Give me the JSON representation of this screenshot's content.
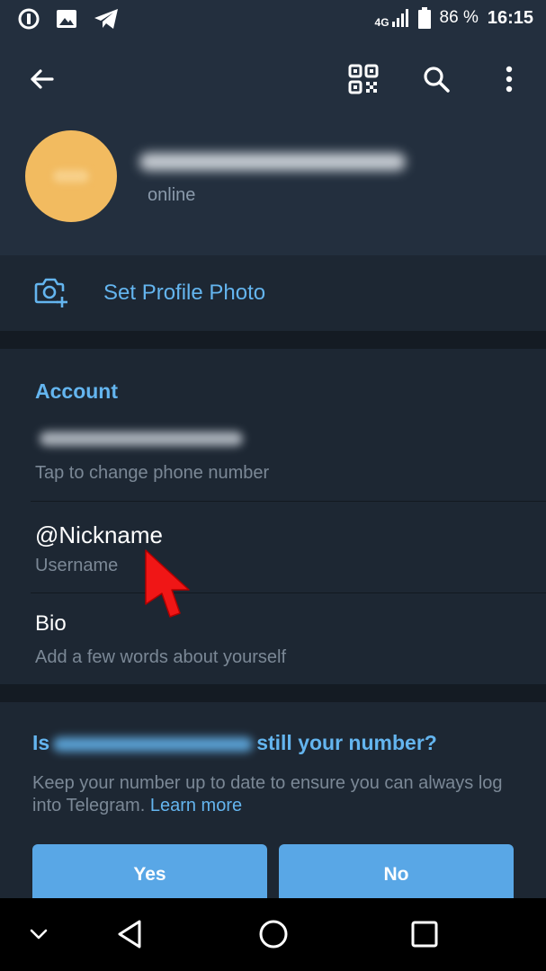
{
  "status_bar": {
    "network": "4G",
    "battery_percent": "86 %",
    "time": "16:15"
  },
  "profile": {
    "status": "online"
  },
  "set_photo": {
    "label": "Set Profile Photo"
  },
  "account": {
    "title": "Account",
    "phone_hint": "Tap to change phone number",
    "username_value": "@Nickname",
    "username_label": "Username",
    "bio_title": "Bio",
    "bio_hint": "Add a few words about yourself"
  },
  "number_check": {
    "question_start": "Is",
    "question_end": "still your number?",
    "description": "Keep your number up to date to ensure you can always log into Telegram.",
    "learn_more": "Learn more",
    "yes_label": "Yes",
    "no_label": "No"
  },
  "colors": {
    "accent": "#64b5ef",
    "background": "#1d2733",
    "header": "#232f3e",
    "button": "#59a7e6",
    "avatar": "#f2bb60"
  }
}
